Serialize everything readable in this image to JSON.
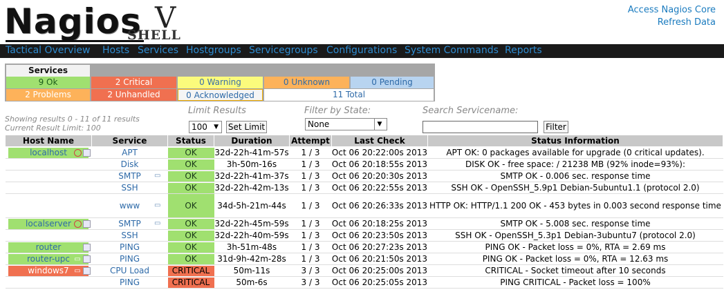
{
  "header": {
    "logo_text": "Nagios",
    "logo_v": "V",
    "logo_shell": "SHELL",
    "links": [
      "Access Nagios Core",
      "Refresh Data"
    ]
  },
  "nav": [
    "Tactical Overview",
    "Hosts",
    "Services",
    "Hostgroups",
    "Servicegroups",
    "Configurations",
    "System Commands",
    "Reports"
  ],
  "summary": {
    "title": "Services",
    "row1": [
      "9 Ok",
      "2 Critical",
      "0 Warning",
      "0 Unknown",
      "0 Pending"
    ],
    "row2": [
      "2 Problems",
      "2 Unhandled",
      "0 Acknowledged",
      "11 Total"
    ]
  },
  "results": {
    "line1": "Showing results 0 - 11 of 11 results",
    "line2": "Current Result Limit: 100"
  },
  "limit": {
    "label": "Limit Results",
    "value": "100",
    "button": "Set Limit"
  },
  "filter": {
    "label": "Filter by State:",
    "value": "None"
  },
  "search": {
    "label": "Search Servicename:",
    "button": "Filter",
    "value": ""
  },
  "columns": [
    "Host Name",
    "Service",
    "Status",
    "Duration",
    "Attempt",
    "Last Check",
    "Status Information"
  ],
  "rows": [
    {
      "host": "localhost",
      "service": "APT",
      "status": "OK",
      "duration": "32d-22h-41m-57s",
      "attempt": "1 / 3",
      "last": "Oct 06 20:22:00s 2013",
      "info": "APT OK: 0 packages available for upgrade (0 critical updates)."
    },
    {
      "host": "",
      "service": "Disk",
      "status": "OK",
      "duration": "3h-50m-16s",
      "attempt": "1 / 3",
      "last": "Oct 06 20:18:55s 2013",
      "info": "DISK OK - free space: / 21238 MB (92% inode=93%):"
    },
    {
      "host": "",
      "service": "SMTP",
      "status": "OK",
      "duration": "32d-22h-41m-37s",
      "attempt": "1 / 3",
      "last": "Oct 06 20:20:30s 2013",
      "info": "SMTP OK - 0.006 sec. response time"
    },
    {
      "host": "",
      "service": "SSH",
      "status": "OK",
      "duration": "32d-22h-42m-13s",
      "attempt": "1 / 3",
      "last": "Oct 06 20:22:55s 2013",
      "info": "SSH OK - OpenSSH_5.9p1 Debian-5ubuntu1.1 (protocol 2.0)"
    },
    {
      "host": "",
      "service": "www",
      "status": "OK",
      "duration": "34d-5h-21m-44s",
      "attempt": "1 / 3",
      "last": "Oct 06 20:26:33s 2013",
      "info": "HTTP OK: HTTP/1.1 200 OK - 453 bytes in 0.003 second response time"
    },
    {
      "host": "localserver",
      "service": "SMTP",
      "status": "OK",
      "duration": "32d-22h-45m-59s",
      "attempt": "1 / 3",
      "last": "Oct 06 20:18:25s 2013",
      "info": "SMTP OK - 5.008 sec. response time"
    },
    {
      "host": "",
      "service": "SSH",
      "status": "OK",
      "duration": "32d-22h-40m-59s",
      "attempt": "1 / 3",
      "last": "Oct 06 20:23:50s 2013",
      "info": "SSH OK - OpenSSH_5.3p1 Debian-3ubuntu7 (protocol 2.0)"
    },
    {
      "host": "router",
      "service": "PING",
      "status": "OK",
      "duration": "3h-51m-48s",
      "attempt": "1 / 3",
      "last": "Oct 06 20:27:23s 2013",
      "info": "PING OK - Packet loss = 0%, RTA = 2.69 ms"
    },
    {
      "host": "router-upc",
      "service": "PING",
      "status": "OK",
      "duration": "31d-9h-42m-28s",
      "attempt": "1 / 3",
      "last": "Oct 06 20:21:50s 2013",
      "info": "PING OK - Packet loss = 0%, RTA = 12.63 ms"
    },
    {
      "host": "windows7",
      "service": "CPU Load",
      "status": "CRITICAL",
      "duration": "50m-11s",
      "attempt": "3 / 3",
      "last": "Oct 06 20:25:00s 2013",
      "info": "CRITICAL - Socket timeout after 10 seconds"
    },
    {
      "host": "",
      "service": "PING",
      "status": "CRITICAL",
      "duration": "50m-6s",
      "attempt": "3 / 3",
      "last": "Oct 06 20:25:05s 2013",
      "info": "PING CRITICAL - Packet loss = 100%"
    }
  ]
}
